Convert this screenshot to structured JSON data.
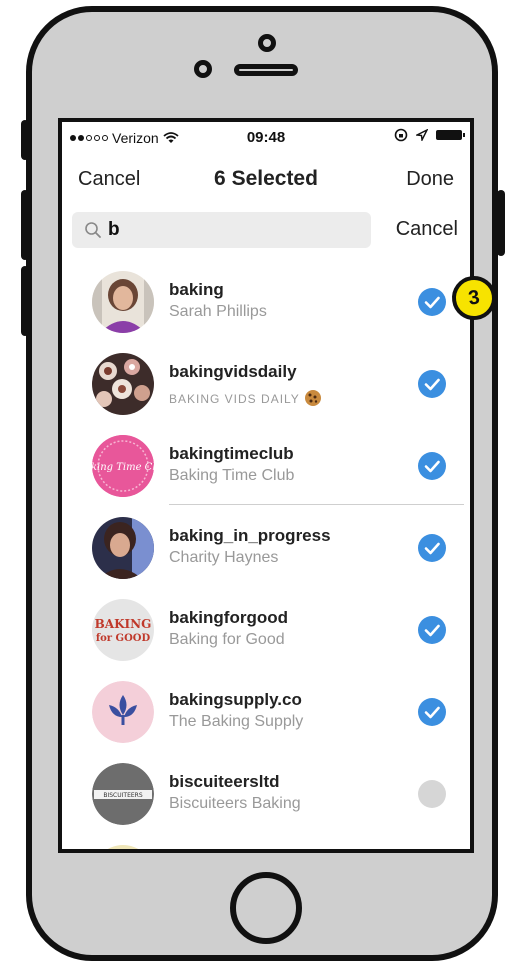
{
  "status_bar": {
    "carrier": "Verizon",
    "time": "09:48"
  },
  "nav": {
    "cancel_label": "Cancel",
    "selected_count": "6",
    "selected_label": "Selected",
    "done_label": "Done"
  },
  "search": {
    "value": "b",
    "cancel_label": "Cancel"
  },
  "results": [
    {
      "username": "baking",
      "fullname": "Sarah Phillips",
      "selected": true
    },
    {
      "username": "bakingvidsdaily",
      "fullname": "BAKING VIDS DAILY",
      "selected": true
    },
    {
      "username": "bakingtimeclub",
      "fullname": "Baking Time Club",
      "selected": true
    },
    {
      "username": "baking_in_progress",
      "fullname": "Charity Haynes",
      "selected": true
    },
    {
      "username": "bakingforgood",
      "fullname": "Baking for Good",
      "selected": true
    },
    {
      "username": "bakingsupply.co",
      "fullname": "The Baking Supply",
      "selected": true
    },
    {
      "username": "biscuiteersltd",
      "fullname": "Biscuiteers Baking",
      "selected": false
    }
  ],
  "avatars": {
    "bakingtimeclub_text": "Baking Time Club",
    "bakingforgood_line1": "BAKING",
    "bakingforgood_line2": "for GOOD",
    "biscuiteers_text": "BISCUITEERS"
  },
  "callout": {
    "number": "3"
  },
  "colors": {
    "check_selected": "#3b8fe0",
    "check_unselected": "#d6d6d6",
    "callout_fill": "#f7e300"
  }
}
